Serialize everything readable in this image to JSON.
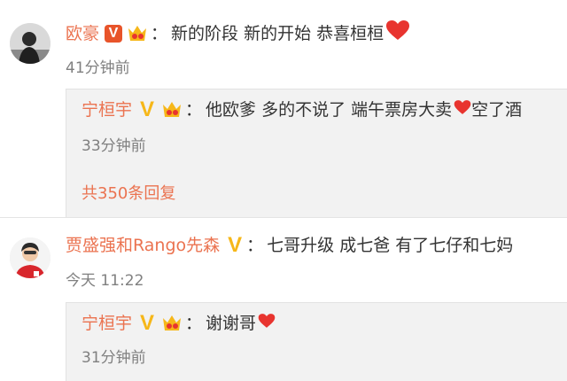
{
  "comments": [
    {
      "user": "欧豪",
      "colon": "：",
      "text": "新的阶段 新的开始 恭喜桓桓",
      "time": "41分钟前",
      "reply": {
        "user": "宁桓宇",
        "colon": "：",
        "text": "他欧爹 多的不说了 端午票房大卖",
        "text_after": " 空了酒",
        "time": "33分钟前",
        "more": "共350条回复"
      }
    },
    {
      "user": "贾盛强和Rango先森",
      "colon": "：",
      "text": "七哥升级 成七爸 有了七仔和七妈",
      "time": "今天 11:22",
      "reply": {
        "user": "宁桓宇",
        "colon": "：",
        "text": "谢谢哥",
        "time": "31分钟前"
      }
    }
  ],
  "colors": {
    "username": "#eb7350",
    "time": "#808080",
    "reply_bg": "#f2f2f2",
    "heart": "#e8342f",
    "verified_red": "#e8542a",
    "verified_gold": "#f6b719"
  },
  "icons": [
    "verified-badge-icon",
    "vip-crown-icon",
    "heart-icon"
  ]
}
